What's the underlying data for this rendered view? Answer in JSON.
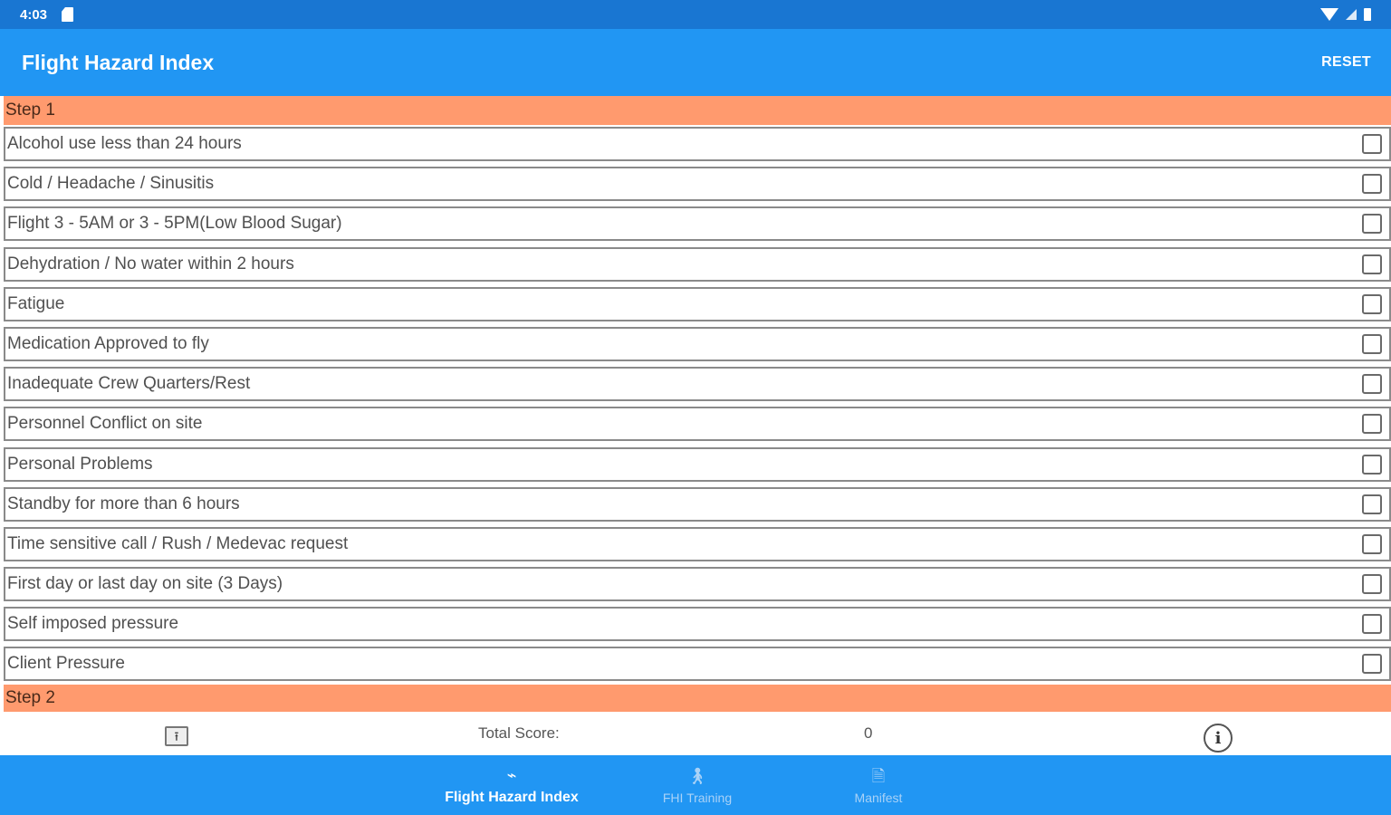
{
  "status_bar": {
    "time": "4:03"
  },
  "app_bar": {
    "title": "Flight Hazard Index",
    "reset_label": "RESET"
  },
  "step1": {
    "label": "Step 1",
    "items": [
      {
        "label": "Alcohol use less than 24 hours",
        "checked": false
      },
      {
        "label": "Cold / Headache / Sinusitis",
        "checked": false
      },
      {
        "label": "Flight 3 - 5AM or 3 - 5PM(Low Blood Sugar)",
        "checked": false
      },
      {
        "label": "Dehydration / No water within 2 hours",
        "checked": false
      },
      {
        "label": "Fatigue",
        "checked": false
      },
      {
        "label": "Medication Approved to fly",
        "checked": false
      },
      {
        "label": "Inadequate Crew Quarters/Rest",
        "checked": false
      },
      {
        "label": "Personnel Conflict on site",
        "checked": false
      },
      {
        "label": "Personal Problems",
        "checked": false
      },
      {
        "label": "Standby for more than 6 hours",
        "checked": false
      },
      {
        "label": "Time sensitive call / Rush / Medevac request",
        "checked": false
      },
      {
        "label": "First day or last day on site (3 Days)",
        "checked": false
      },
      {
        "label": "Self imposed pressure",
        "checked": false
      },
      {
        "label": "Client Pressure",
        "checked": false
      }
    ]
  },
  "step2": {
    "label": "Step 2"
  },
  "score": {
    "label": "Total Score:",
    "value": "0"
  },
  "bottom_nav": {
    "items": [
      {
        "label": "Flight Hazard Index",
        "icon": "helicopter-icon",
        "active": true
      },
      {
        "label": "FHI Training",
        "icon": "person-walking-icon",
        "active": false
      },
      {
        "label": "Manifest",
        "icon": "document-icon",
        "active": false
      }
    ]
  },
  "colors": {
    "status_bar": "#1976d2",
    "app_bar": "#2196f3",
    "step_header": "#ff9a6e",
    "nav_inactive": "#a9d2f7"
  }
}
